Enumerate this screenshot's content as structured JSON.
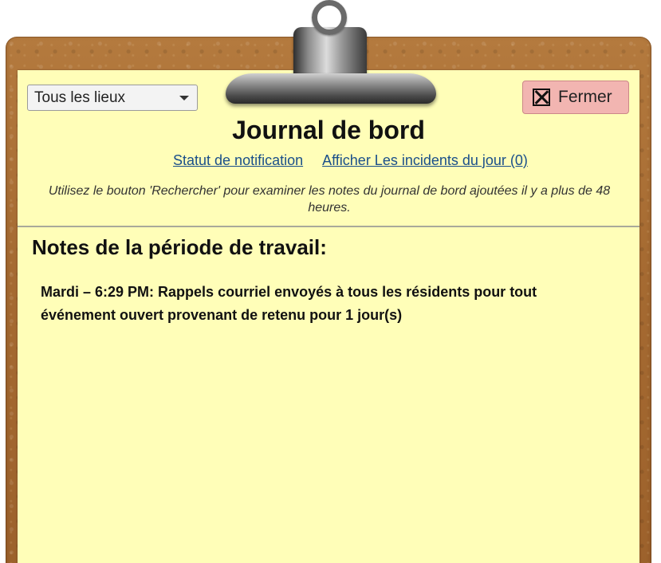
{
  "location_filter": {
    "selected": "Tous les lieux"
  },
  "toolbar": {
    "close_label": "Fermer"
  },
  "header": {
    "title": "Journal de bord",
    "links": [
      "Statut de notification",
      "Afficher Les incidents du jour (0)"
    ],
    "hint": "Utilisez le bouton 'Rechercher' pour examiner les notes du journal de bord ajoutées il y a plus de 48 heures."
  },
  "notes": {
    "heading": "Notes de la période de travail:",
    "entries": [
      "Mardi – 6:29 PM: Rappels courriel envoyés à tous les résidents pour tout événement ouvert provenant de retenu pour 1 jour(s)"
    ]
  },
  "colors": {
    "paper": "#fffeb8",
    "board": "#a66b32",
    "close_button": "#f2b5b1",
    "link": "#1a4f8a"
  }
}
